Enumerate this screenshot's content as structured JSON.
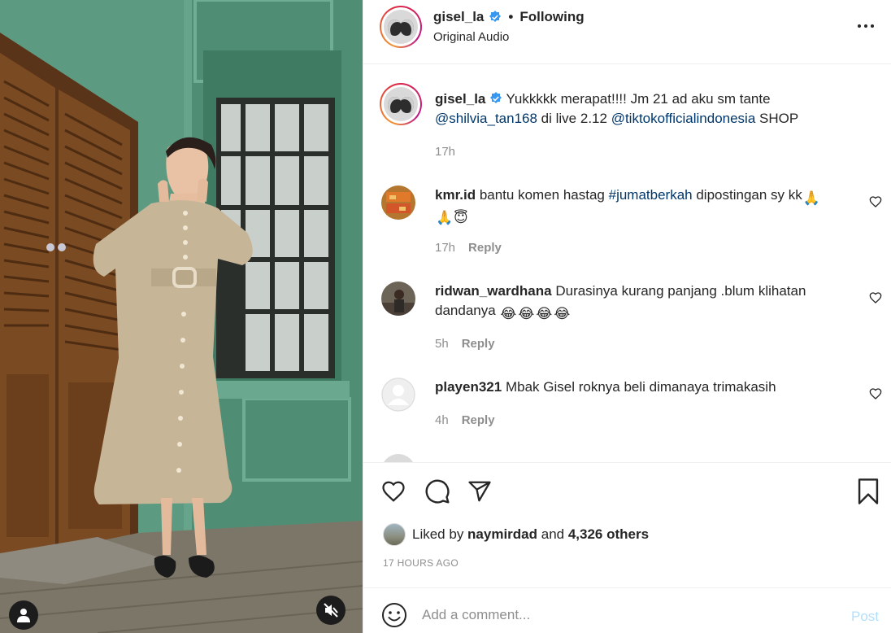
{
  "header": {
    "username": "gisel_la",
    "separator": "•",
    "follow_label": "Following",
    "audio": "Original Audio",
    "more_icon": "more-horizontal-icon"
  },
  "caption": {
    "username": "gisel_la",
    "text_1": " Yukkkkk merapat!!!! Jm 21 ad aku sm tante ",
    "mention_1": "@shilvia_tan168",
    "text_2": " di live 2.12 ",
    "mention_2": "@tiktokofficialindonesia",
    "text_3": " SHOP",
    "time": "17h"
  },
  "comments": [
    {
      "username": "kmr.id",
      "text_1": " bantu komen hastag ",
      "hashtag": "#jumatberkah",
      "text_2": " dipostingan sy kk",
      "emojis": [
        "🙏",
        "🙏",
        "😇"
      ],
      "time": "17h",
      "reply_label": "Reply"
    },
    {
      "username": "ridwan_wardhana",
      "text": " Durasinya kurang panjang .blum klihatan dandanya ",
      "emojis": [
        "😂",
        "😂",
        "😂",
        "😂"
      ],
      "time": "5h",
      "reply_label": "Reply"
    },
    {
      "username": "playen321",
      "text": " Mbak Gisel roknya beli dimanaya trimakasih",
      "time": "4h",
      "reply_label": "Reply"
    }
  ],
  "actions": {
    "icons": [
      "heart-icon",
      "comment-icon",
      "share-icon",
      "bookmark-icon"
    ]
  },
  "likes": {
    "prefix": "Liked by ",
    "user": "naymirdad",
    "middle": " and ",
    "count": "4,326 others"
  },
  "timestamp": "17 HOURS AGO",
  "comment_box": {
    "placeholder": "Add a comment...",
    "post_label": "Post"
  },
  "colors": {
    "link": "#00376b",
    "verified": "#3897f0",
    "muted": "#8e8e8e",
    "post_disabled": "#b2dffc"
  }
}
